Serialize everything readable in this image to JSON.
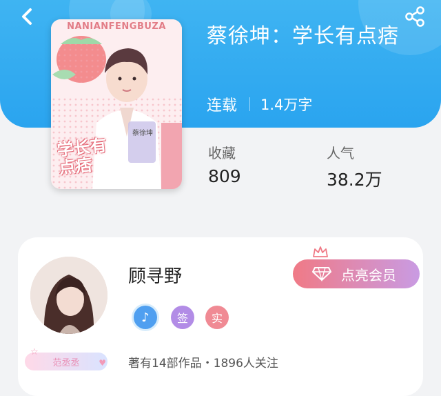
{
  "colors": {
    "hero": "#2aa4ef",
    "member_gradient_start": "#f07a86",
    "member_gradient_end": "#c99be3"
  },
  "header": {
    "back_icon": "chevron-left-icon",
    "share_icon": "share-icon"
  },
  "book": {
    "cover_text_top": "NANIANFENGBUZA",
    "cover_art_title": "学长有点痞",
    "cover_name_tag": "蔡徐坤",
    "title": "蔡徐坤：学长有点痞",
    "status": "连载",
    "word_count": "1.4万字",
    "stats": {
      "favorites_label": "收藏",
      "favorites_value": "809",
      "popularity_label": "人气",
      "popularity_value": "38.2万"
    }
  },
  "author": {
    "name": "顾寻野",
    "member_button": "点亮会员",
    "badges": [
      {
        "icon": "music-note-icon",
        "color": "#4f9ff0"
      },
      {
        "label": "签",
        "color": "#b28ce6"
      },
      {
        "label": "实",
        "color": "#f08a94"
      }
    ],
    "tag_label": "范丞丞",
    "works_info": "著有14部作品・1896人关注"
  }
}
